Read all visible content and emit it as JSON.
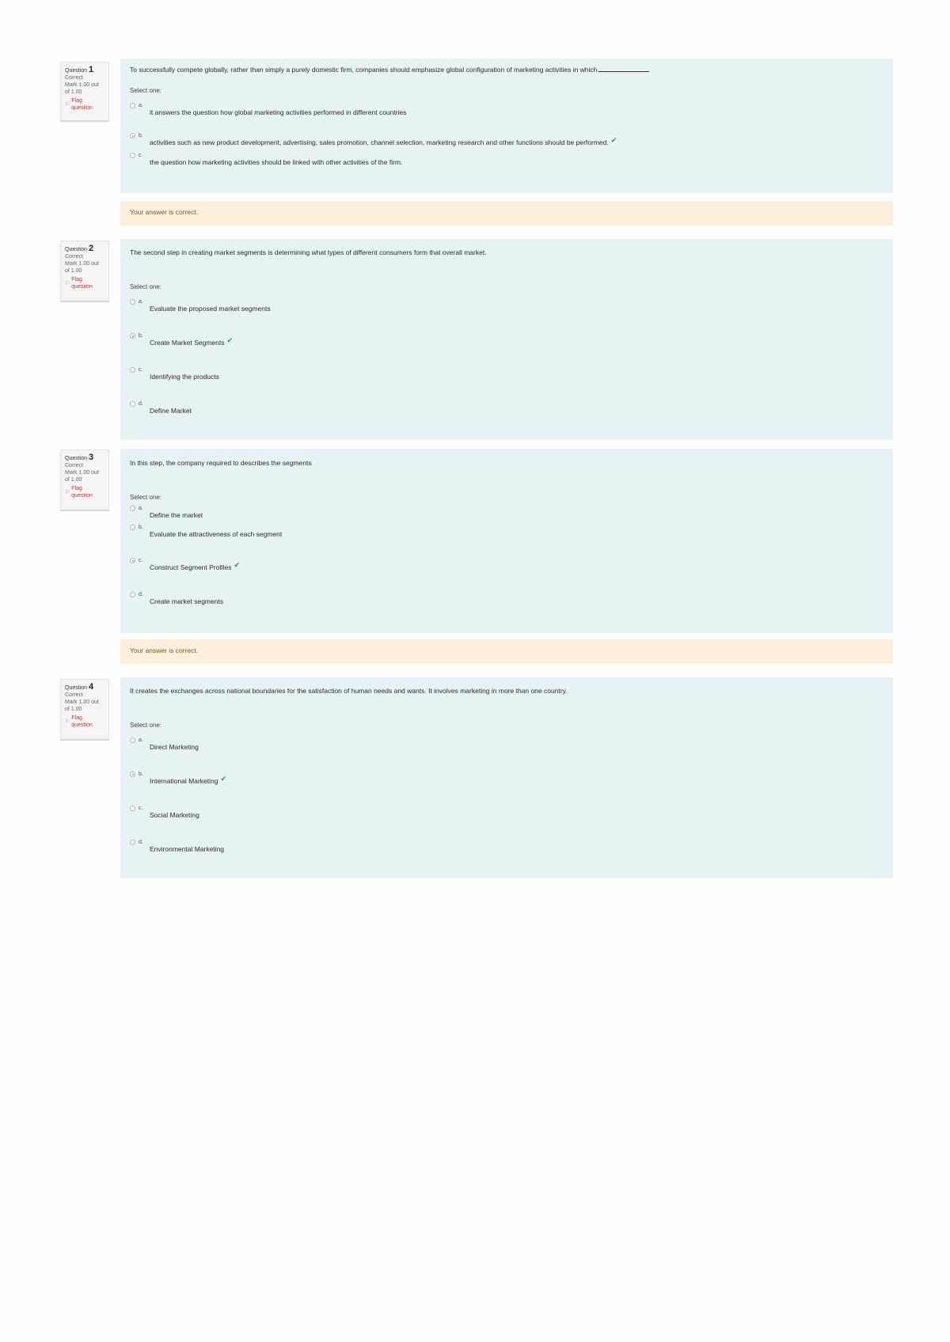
{
  "questions": [
    {
      "label": "Question",
      "number": "1",
      "state": "Correct",
      "mark": "Mark 1.00 out of 1.00",
      "flag": "Flag question",
      "text": "To successfully compete globally, rather than simply a purely domestic firm, companies should emphasize global configuration of marketing activities in which",
      "prompt": "Select one:",
      "options": [
        {
          "letter": "a.",
          "text": "it answers the question how global marketing activities performed in different countries",
          "checked": false,
          "correct": false
        },
        {
          "letter": "b.",
          "text": "activities such as new product development, advertising, sales promotion, channel selection, marketing research and other functions should be performed.",
          "checked": true,
          "correct": true
        },
        {
          "letter": "c.",
          "text": "the question how marketing activities should be linked with other activities of the firm.",
          "checked": false,
          "correct": false
        }
      ],
      "feedback": "Your answer is correct."
    },
    {
      "label": "Question",
      "number": "2",
      "state": "Correct",
      "mark": "Mark 1.00 out of 1.00",
      "flag": "Flag question",
      "text": "The second step in creating market segments is determining what types of different consumers form that overall market.",
      "prompt": "Select one:",
      "options": [
        {
          "letter": "a.",
          "text": "Evaluate the proposed market segments",
          "checked": false,
          "correct": false
        },
        {
          "letter": "b.",
          "text": "Create Market Segments",
          "checked": true,
          "correct": true
        },
        {
          "letter": "c.",
          "text": "Identifying the products",
          "checked": false,
          "correct": false
        },
        {
          "letter": "d.",
          "text": "Define Market",
          "checked": false,
          "correct": false
        }
      ]
    },
    {
      "label": "Question",
      "number": "3",
      "state": "Correct",
      "mark": "Mark 1.00 out of 1.00",
      "flag": "Flag question",
      "text": "In this step, the company required to describes the segments",
      "prompt": "Select one:",
      "options": [
        {
          "letter": "a.",
          "text": "Define the market",
          "checked": false,
          "correct": false
        },
        {
          "letter": "b.",
          "text": "Evaluate the attractiveness of each segment",
          "checked": false,
          "correct": false
        },
        {
          "letter": "c.",
          "text": "Construct Segment Profiles",
          "checked": true,
          "correct": true
        },
        {
          "letter": "d.",
          "text": "Create market segments",
          "checked": false,
          "correct": false
        }
      ],
      "feedback": "Your answer is correct."
    },
    {
      "label": "Question",
      "number": "4",
      "state": "Correct",
      "mark": "Mark 1.00 out of 1.00",
      "flag": "Flag question",
      "text": "It creates the exchanges across national boundaries for the satisfaction of human needs and wants. It involves marketing in more than one country.",
      "prompt": "Select one:",
      "options": [
        {
          "letter": "a.",
          "text": "Direct Marketing",
          "checked": false,
          "correct": false
        },
        {
          "letter": "b.",
          "text": "International Marketing",
          "checked": true,
          "correct": true
        },
        {
          "letter": "c.",
          "text": "Social Marketing",
          "checked": false,
          "correct": false
        },
        {
          "letter": "d.",
          "text": "Environmental Marketing",
          "checked": false,
          "correct": false
        }
      ]
    }
  ]
}
